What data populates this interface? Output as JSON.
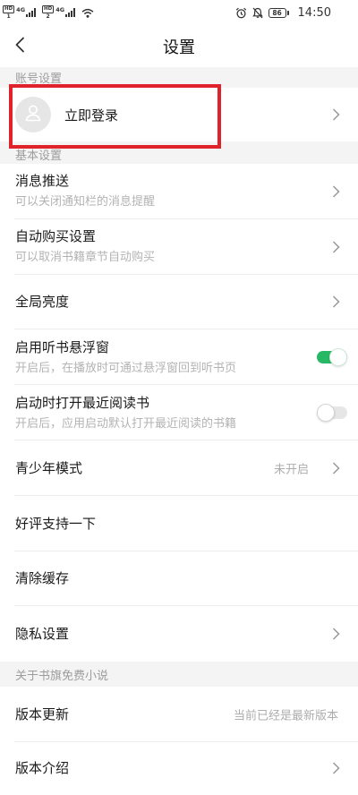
{
  "status_bar": {
    "sim1": {
      "badge": "HD",
      "slot": "1",
      "network": "4G"
    },
    "sim2": {
      "badge": "HD",
      "slot": "2",
      "network": "4G"
    },
    "battery": "86",
    "time": "14:50"
  },
  "header": {
    "title": "设置"
  },
  "account": {
    "section_title": "账号设置",
    "login_label": "立即登录"
  },
  "basic": {
    "section_title": "基本设置",
    "items": [
      {
        "label": "消息推送",
        "subtitle": "可以关闭通知栏的消息提醒"
      },
      {
        "label": "自动购买设置",
        "subtitle": "可以取消书籍章节自动购买"
      },
      {
        "label": "全局亮度"
      },
      {
        "label": "启用听书悬浮窗",
        "subtitle": "开启后，在播放时可通过悬浮窗回到听书页",
        "toggle_on": true
      },
      {
        "label": "启动时打开最近阅读书",
        "subtitle": "开启后，应用启动默认打开最近阅读的书籍",
        "toggle_on": false
      },
      {
        "label": "青少年模式",
        "value": "未开启"
      },
      {
        "label": "好评支持一下"
      },
      {
        "label": "清除缓存"
      },
      {
        "label": "隐私设置"
      }
    ]
  },
  "about": {
    "section_title": "关于书旗免费小说",
    "items": [
      {
        "label": "版本更新",
        "value": "当前已经是最新版本"
      },
      {
        "label": "版本介绍"
      }
    ]
  },
  "icons": {
    "signal": "signal-icon",
    "wifi": "wifi-icon",
    "alarm": "alarm-icon",
    "mute": "mute-icon",
    "battery": "battery-icon",
    "back": "chevron-left-icon",
    "avatar": "person-icon",
    "row_arrow": "chevron-right-icon"
  },
  "colors": {
    "accent": "#26b865",
    "highlight_box": "#e0222b",
    "section_background": "#f4f4f4"
  }
}
